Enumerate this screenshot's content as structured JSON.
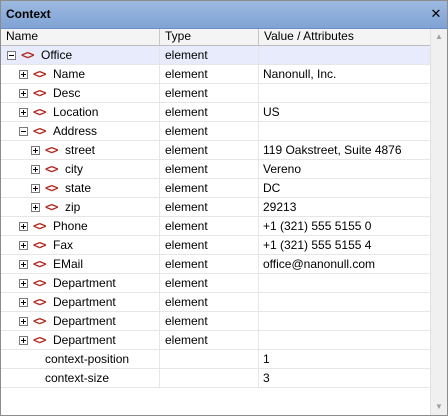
{
  "window": {
    "title": "Context",
    "close_glyph": "✕"
  },
  "columns": {
    "name": "Name",
    "type": "Type",
    "value": "Value / Attributes"
  },
  "scrollbar": {
    "up_glyph": "▲",
    "down_glyph": "▼"
  },
  "rows": [
    {
      "name": "Office",
      "type": "element",
      "value": "",
      "level": 0,
      "expander": "minus",
      "icon": "element-icon",
      "selected": true
    },
    {
      "name": "Name",
      "type": "element",
      "value": "Nanonull, Inc.",
      "level": 1,
      "expander": "plus",
      "icon": "element-icon"
    },
    {
      "name": "Desc",
      "type": "element",
      "value": "",
      "level": 1,
      "expander": "plus",
      "icon": "element-icon"
    },
    {
      "name": "Location",
      "type": "element",
      "value": "US",
      "level": 1,
      "expander": "plus",
      "icon": "element-icon"
    },
    {
      "name": "Address",
      "type": "element",
      "value": "",
      "level": 1,
      "expander": "minus",
      "icon": "element-icon"
    },
    {
      "name": "street",
      "type": "element",
      "value": "119 Oakstreet, Suite 4876",
      "level": 2,
      "expander": "plus",
      "icon": "element-icon"
    },
    {
      "name": "city",
      "type": "element",
      "value": "Vereno",
      "level": 2,
      "expander": "plus",
      "icon": "element-icon"
    },
    {
      "name": "state",
      "type": "element",
      "value": "DC",
      "level": 2,
      "expander": "plus",
      "icon": "element-icon"
    },
    {
      "name": "zip",
      "type": "element",
      "value": "29213",
      "level": 2,
      "expander": "plus",
      "icon": "element-icon"
    },
    {
      "name": "Phone",
      "type": "element",
      "value": "+1 (321) 555 5155 0",
      "level": 1,
      "expander": "plus",
      "icon": "element-icon"
    },
    {
      "name": "Fax",
      "type": "element",
      "value": "+1 (321) 555 5155 4",
      "level": 1,
      "expander": "plus",
      "icon": "element-icon"
    },
    {
      "name": "EMail",
      "type": "element",
      "value": "office@nanonull.com",
      "level": 1,
      "expander": "plus",
      "icon": "element-icon"
    },
    {
      "name": "Department",
      "type": "element",
      "value": "",
      "level": 1,
      "expander": "plus",
      "icon": "element-icon"
    },
    {
      "name": "Department",
      "type": "element",
      "value": "",
      "level": 1,
      "expander": "plus",
      "icon": "element-icon"
    },
    {
      "name": "Department",
      "type": "element",
      "value": "",
      "level": 1,
      "expander": "plus",
      "icon": "element-icon"
    },
    {
      "name": "Department",
      "type": "element",
      "value": "",
      "level": 1,
      "expander": "plus",
      "icon": "element-icon"
    },
    {
      "name": "context-position",
      "type": "",
      "value": "1",
      "level": 1,
      "expander": "none",
      "icon": "none"
    },
    {
      "name": "context-size",
      "type": "",
      "value": "3",
      "level": 1,
      "expander": "none",
      "icon": "none"
    }
  ],
  "icon_glyph": "<>",
  "colors": {
    "titlebar": "#8fb0dc",
    "selected_row": "#e7ebfb",
    "element_icon": "#b0251b"
  }
}
